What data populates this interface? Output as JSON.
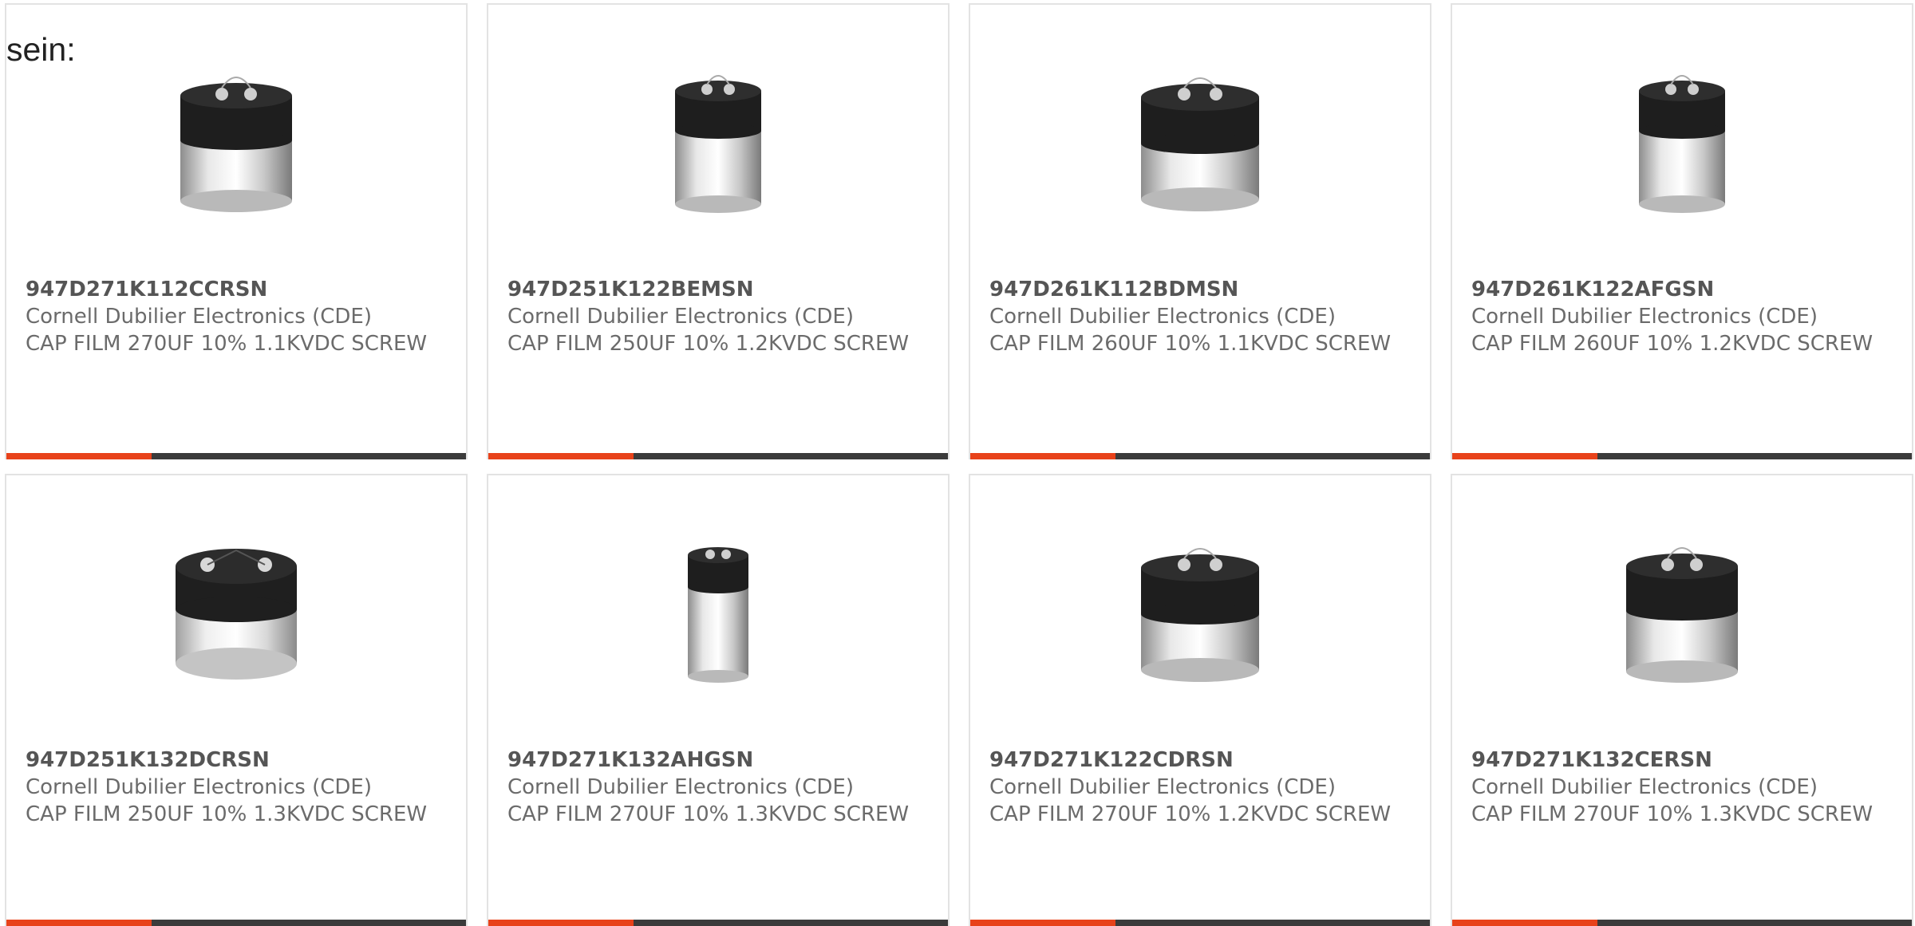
{
  "lead_text": "sein:",
  "colors": {
    "accent": "#e8421a",
    "bar": "#3b3b3b",
    "card_border": "#e3e3e3",
    "text_muted": "#6b6b6b"
  },
  "products": [
    {
      "part_number": "947D271K112CCRSN",
      "manufacturer": "Cornell Dubilier Electronics (CDE)",
      "description": "CAP FILM 270UF 10% 1.1KVDC SCREW",
      "image_icon": "capacitor-can-icon"
    },
    {
      "part_number": "947D251K122BEMSN",
      "manufacturer": "Cornell Dubilier Electronics (CDE)",
      "description": "CAP FILM 250UF 10% 1.2KVDC SCREW",
      "image_icon": "capacitor-can-icon"
    },
    {
      "part_number": "947D261K112BDMSN",
      "manufacturer": "Cornell Dubilier Electronics (CDE)",
      "description": "CAP FILM 260UF 10% 1.1KVDC SCREW",
      "image_icon": "capacitor-can-icon"
    },
    {
      "part_number": "947D261K122AFGSN",
      "manufacturer": "Cornell Dubilier Electronics (CDE)",
      "description": "CAP FILM 260UF 10% 1.2KVDC SCREW",
      "image_icon": "capacitor-can-icon"
    },
    {
      "part_number": "947D251K132DCRSN",
      "manufacturer": "Cornell Dubilier Electronics (CDE)",
      "description": "CAP FILM 250UF 10% 1.3KVDC SCREW",
      "image_icon": "capacitor-can-icon"
    },
    {
      "part_number": "947D271K132AHGSN",
      "manufacturer": "Cornell Dubilier Electronics (CDE)",
      "description": "CAP FILM 270UF 10% 1.3KVDC SCREW",
      "image_icon": "capacitor-can-icon"
    },
    {
      "part_number": "947D271K122CDRSN",
      "manufacturer": "Cornell Dubilier Electronics (CDE)",
      "description": "CAP FILM 270UF 10% 1.2KVDC SCREW",
      "image_icon": "capacitor-can-icon"
    },
    {
      "part_number": "947D271K132CERSN",
      "manufacturer": "Cornell Dubilier Electronics (CDE)",
      "description": "CAP FILM 270UF 10% 1.3KVDC SCREW",
      "image_icon": "capacitor-can-icon"
    }
  ]
}
